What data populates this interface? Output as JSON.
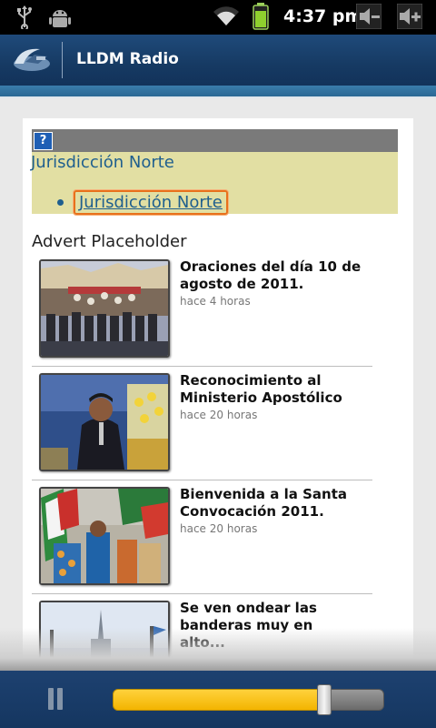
{
  "status_bar": {
    "time": "4:37 pm",
    "icons": [
      "usb-icon",
      "android-debug-icon",
      "wifi-icon",
      "battery-icon",
      "volume-down-icon",
      "volume-up-icon"
    ]
  },
  "app": {
    "title": "LLDM Radio",
    "logo": "lldm-logo"
  },
  "widget": {
    "help_label": "?",
    "heading": "Jurisdicción Norte",
    "link": "Jurisdicción Norte",
    "link_focus_color": "#e8711c"
  },
  "advert": "Advert Placeholder",
  "news": [
    {
      "title": "Oraciones del día 10 de agosto de 2011.",
      "time": "hace 4 horas"
    },
    {
      "title": "Reconocimiento al Ministerio Apostólico",
      "time": "hace 20 horas"
    },
    {
      "title": "Bienvenida a la Santa Convocación 2011.",
      "time": "hace 20 horas"
    },
    {
      "title": "Se ven ondear las banderas muy en alto...",
      "time": ""
    }
  ],
  "player": {
    "pause_icon": "pause-icon",
    "progress_fraction": 0.78,
    "accent": "#f7c21a"
  }
}
